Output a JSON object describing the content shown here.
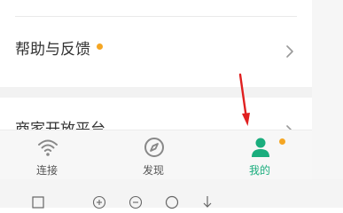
{
  "settings_list": {
    "help_row": {
      "label": "帮助与反馈",
      "has_badge": true
    },
    "partial_row": {
      "label": "商家开放平台"
    }
  },
  "tabbar": {
    "tabs": [
      {
        "label": "连接",
        "icon": "wifi-icon",
        "active": false
      },
      {
        "label": "发现",
        "icon": "compass-icon",
        "active": false
      },
      {
        "label": "我的",
        "icon": "person-icon",
        "active": true,
        "has_badge": true
      }
    ]
  },
  "annotation": {
    "type": "red-arrow",
    "points_to": "tab-mine"
  },
  "emulator_toolbar": {
    "buttons": [
      "square-icon",
      "zoom-in-icon",
      "zoom-out-icon",
      "circle-icon",
      "download-icon"
    ]
  },
  "colors": {
    "accent_green": "#1aad7d",
    "badge_orange": "#f5a623",
    "arrow_red": "#e02020",
    "text_primary": "#333333",
    "tab_text": "#555555"
  }
}
